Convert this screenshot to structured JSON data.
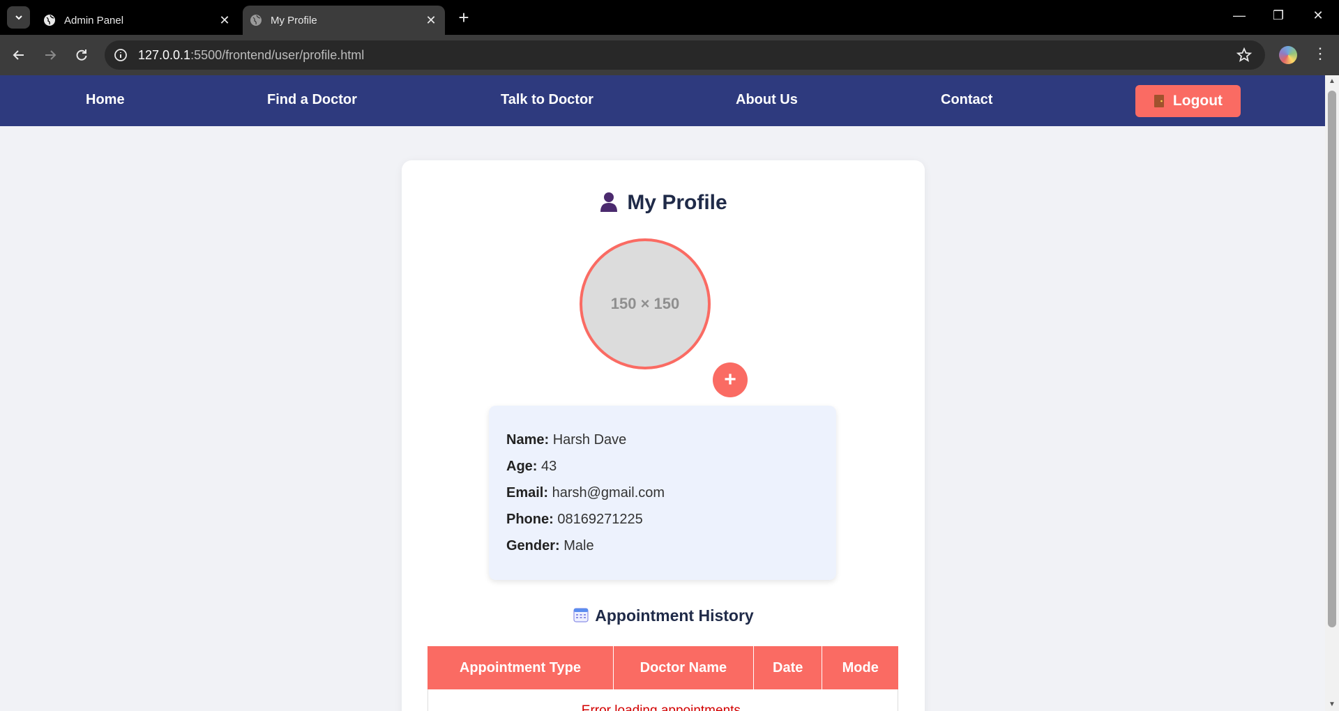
{
  "browser": {
    "tabs": [
      {
        "title": "Admin Panel",
        "active": false
      },
      {
        "title": "My Profile",
        "active": true
      }
    ],
    "url_host": "127.0.0.1",
    "url_rest": ":5500/frontend/user/profile.html"
  },
  "nav": {
    "items": [
      "Home",
      "Find a Doctor",
      "Talk to Doctor",
      "About Us",
      "Contact"
    ],
    "logout_label": "Logout"
  },
  "profile": {
    "title": "My Profile",
    "image_placeholder": "150 × 150",
    "add_photo": "+",
    "fields": [
      {
        "label": "Name:",
        "value": "Harsh Dave"
      },
      {
        "label": "Age:",
        "value": "43"
      },
      {
        "label": "Email:",
        "value": "harsh@gmail.com"
      },
      {
        "label": "Phone:",
        "value": "08169271225"
      },
      {
        "label": "Gender:",
        "value": "Male"
      }
    ]
  },
  "appointments": {
    "title": "Appointment History",
    "columns": [
      "Appointment Type",
      "Doctor Name",
      "Date",
      "Mode"
    ],
    "message": "Error loading appointments."
  },
  "colors": {
    "nav_bg": "#2e3a7e",
    "accent": "#fa6b63",
    "page_bg": "#f1f2f6",
    "info_bg": "#edf2fd",
    "error": "#d20000"
  }
}
